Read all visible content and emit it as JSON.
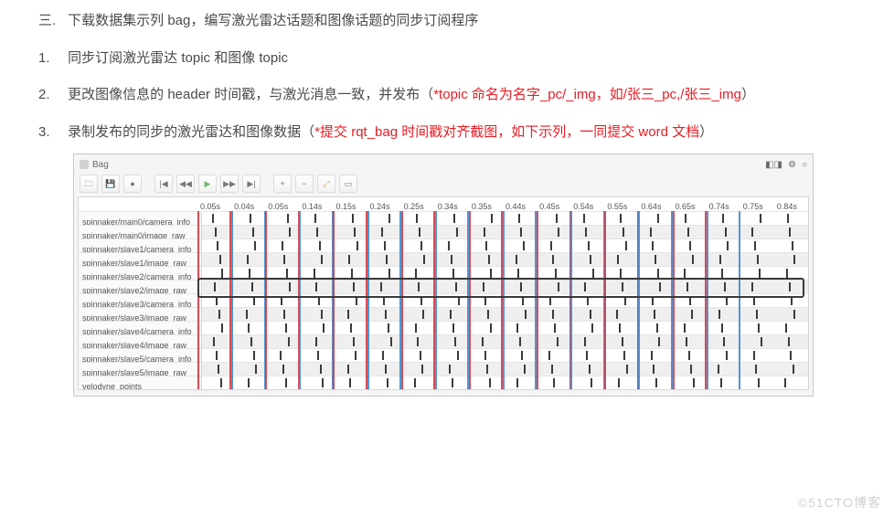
{
  "doc": {
    "h2": {
      "num": "三.",
      "text": "下载数据集示列 bag，编写激光雷达话题和图像话题的同步订阅程序"
    },
    "p1": {
      "num": "1.",
      "text": "同步订阅激光雷达 topic 和图像 topic"
    },
    "p2": {
      "num": "2.",
      "part1": "更改图像信息的 header 时间戳，与激光消息一致，并发布（",
      "red": "*topic 命名为名字_pc/_img，如/张三_pc,/张三_img",
      "part2": "）"
    },
    "p3": {
      "num": "3.",
      "part1": "录制发布的同步的激光雷达和图像数据（",
      "red": "*提交 rqt_bag 时间戳对齐截图，如下示列，一同提交 word 文档",
      "part2": "）"
    }
  },
  "rqt_bag": {
    "title": "Bag",
    "time_labels": [
      "0.05s",
      "0.04s",
      "0.05s",
      "0.14s",
      "0.15s",
      "0.24s",
      "0.25s",
      "0.34s",
      "0.35s",
      "0.44s",
      "0.45s",
      "0.54s",
      "0.55s",
      "0.64s",
      "0.65s",
      "0.74s",
      "0.75s",
      "0.84s"
    ],
    "topics": [
      "spinnaker/main0/camera_info",
      "spinnaker/main0/image_raw",
      "spinnaker/slave1/camera_info",
      "spinnaker/slave1/image_raw",
      "spinnaker/slave2/camera_info",
      "spinnaker/slave2/image_raw",
      "spinnaker/slave3/camera_info",
      "spinnaker/slave3/image_raw",
      "spinnaker/slave4/camera_info",
      "spinnaker/slave4/image_raw",
      "spinnaker/slave5/camera_info",
      "spinnaker/slave5/image_raw",
      "velodyne_points"
    ]
  },
  "watermark": "©51CTO博客"
}
